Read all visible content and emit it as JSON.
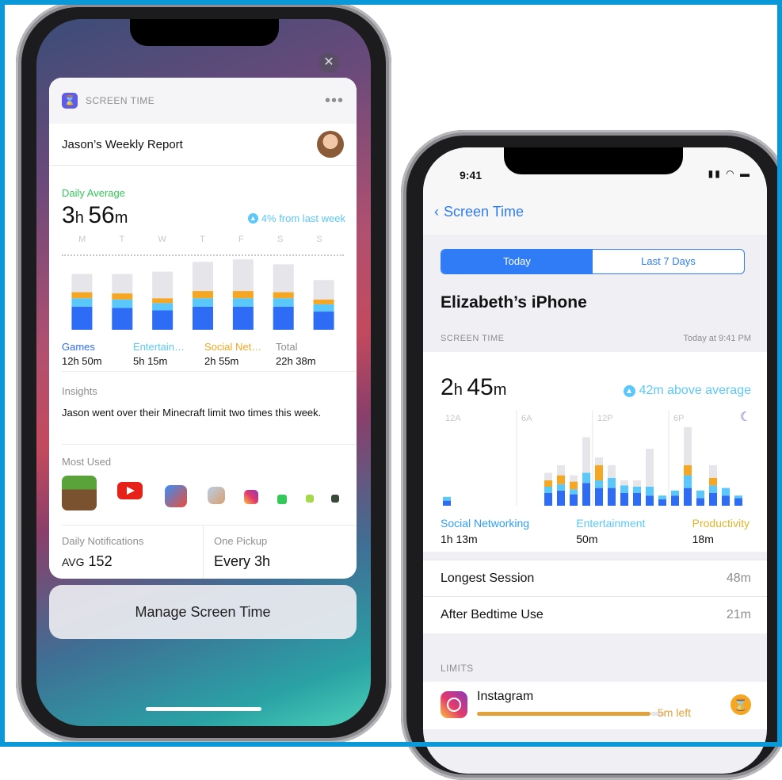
{
  "left_phone": {
    "widget": {
      "app_name": "SCREEN TIME",
      "more_label": "•••",
      "report_title": "Jason’s Weekly Report",
      "daily_average_label": "Daily Average",
      "daily_average_h": "3",
      "daily_average_m": "56",
      "change_text": "4% from last week",
      "days": [
        "M",
        "T",
        "W",
        "T",
        "F",
        "S",
        "S"
      ],
      "week_chart": {
        "type": "bar",
        "categories": [
          "M",
          "T",
          "W",
          "T",
          "F",
          "S",
          "S"
        ],
        "colors": {
          "games": "#2f6cf6",
          "entertainment": "#5ac8fa",
          "social": "#f5a623",
          "other": "#e5e5ea"
        },
        "series": [
          {
            "name": "Games",
            "values": [
              1.9,
              1.8,
              1.6,
              1.9,
              1.9,
              1.9,
              1.5
            ]
          },
          {
            "name": "Entertain…",
            "values": [
              0.7,
              0.7,
              0.6,
              0.7,
              0.7,
              0.7,
              0.6
            ]
          },
          {
            "name": "Social Net…",
            "values": [
              0.5,
              0.5,
              0.4,
              0.6,
              0.6,
              0.5,
              0.4
            ]
          },
          {
            "name": "Other",
            "values": [
              1.5,
              1.6,
              2.2,
              2.4,
              2.6,
              2.3,
              1.6
            ]
          }
        ]
      },
      "categories": [
        {
          "name": "Games",
          "value": "12h 50m",
          "color": "#2f6cf6"
        },
        {
          "name": "Entertain…",
          "value": "5h 15m",
          "color": "#5ac8fa"
        },
        {
          "name": "Social Net…",
          "value": "2h 55m",
          "color": "#f5a623"
        },
        {
          "name": "Total",
          "value": "22h 38m",
          "color": "#8e8e93"
        }
      ],
      "insights_label": "Insights",
      "insights_text": "Jason went over their Minecraft limit two times this week.",
      "most_used_label": "Most Used",
      "most_used_apps": [
        "minecraft-icon",
        "youtube-icon",
        "game-icon",
        "photo-app-icon",
        "instagram-icon",
        "messages-icon",
        "app-icon",
        "app-icon"
      ],
      "daily_notifications_label": "Daily Notifications",
      "avg_prefix": "AVG",
      "avg_value": "152",
      "pickup_label": "One Pickup",
      "pickup_value": "Every 3h"
    },
    "manage_button": "Manage Screen Time"
  },
  "right_phone": {
    "clock": "9:41",
    "back_label": "Screen Time",
    "segments": [
      "Today",
      "Last 7 Days"
    ],
    "device_name": "Elizabeth’s iPhone",
    "section_screen_time": "SCREEN TIME",
    "section_time": "Today at 9:41 PM",
    "total_h": "2",
    "total_m": "45",
    "delta_text": "42m above average",
    "hour_labels": [
      "12A",
      "6A",
      "12P",
      "6P"
    ],
    "day_chart": {
      "type": "bar",
      "colors": {
        "social": "#2f6cf6",
        "entertainment": "#5ac8fa",
        "productivity": "#f5a623",
        "other": "#e5e5ea"
      },
      "bars": [
        {
          "hour": 0,
          "s": 4,
          "e": 3,
          "p": 0,
          "o": 0
        },
        {
          "hour": 8,
          "s": 10,
          "e": 5,
          "p": 5,
          "o": 6
        },
        {
          "hour": 9,
          "s": 12,
          "e": 5,
          "p": 7,
          "o": 8
        },
        {
          "hour": 10,
          "s": 9,
          "e": 4,
          "p": 6,
          "o": 5
        },
        {
          "hour": 11,
          "s": 18,
          "e": 8,
          "p": 0,
          "o": 28
        },
        {
          "hour": 12,
          "s": 14,
          "e": 6,
          "p": 12,
          "o": 6
        },
        {
          "hour": 13,
          "s": 14,
          "e": 8,
          "p": 0,
          "o": 10
        },
        {
          "hour": 14,
          "s": 10,
          "e": 6,
          "p": 0,
          "o": 4
        },
        {
          "hour": 15,
          "s": 10,
          "e": 5,
          "p": 0,
          "o": 5
        },
        {
          "hour": 16,
          "s": 8,
          "e": 7,
          "p": 0,
          "o": 30
        },
        {
          "hour": 17,
          "s": 5,
          "e": 3,
          "p": 0,
          "o": 0
        },
        {
          "hour": 18,
          "s": 8,
          "e": 4,
          "p": 0,
          "o": 0
        },
        {
          "hour": 19,
          "s": 14,
          "e": 10,
          "p": 8,
          "o": 30
        },
        {
          "hour": 20,
          "s": 6,
          "e": 6,
          "p": 0,
          "o": 0
        },
        {
          "hour": 21,
          "s": 10,
          "e": 6,
          "p": 6,
          "o": 10
        },
        {
          "hour": 22,
          "s": 8,
          "e": 6,
          "p": 0,
          "o": 0
        },
        {
          "hour": 23,
          "s": 6,
          "e": 2,
          "p": 0,
          "o": 0
        }
      ]
    },
    "legend": [
      {
        "name": "Social Networking",
        "value": "1h 13m",
        "color": "#2f9ef6"
      },
      {
        "name": "Entertainment",
        "value": "50m",
        "color": "#5ac8fa"
      },
      {
        "name": "Productivity",
        "value": "18m",
        "color": "#e0b32a"
      }
    ],
    "longest_session_label": "Longest Session",
    "longest_session_value": "48m",
    "after_bedtime_label": "After Bedtime Use",
    "after_bedtime_value": "21m",
    "limits_label": "LIMITS",
    "limit_app": "Instagram",
    "limit_left": "5m left",
    "limit_progress": 0.92
  }
}
